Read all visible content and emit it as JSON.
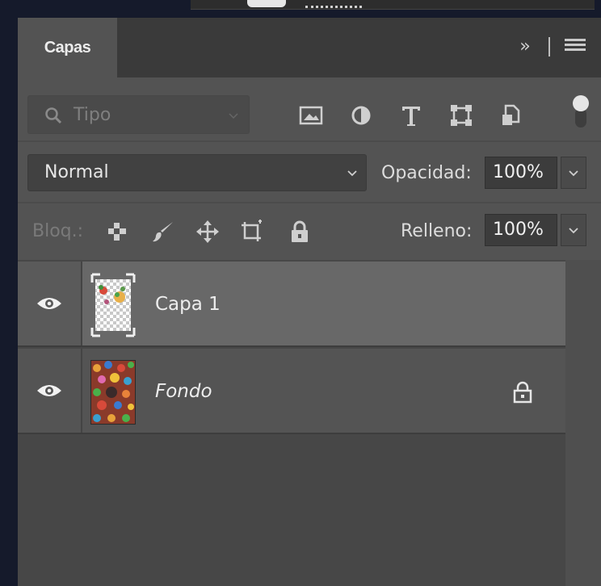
{
  "panel": {
    "tab_label": "Capas"
  },
  "filter": {
    "placeholder": "Tipo",
    "icons": [
      "image-filter-icon",
      "adjustment-filter-icon",
      "type-filter-icon",
      "shape-filter-icon",
      "smart-object-filter-icon"
    ]
  },
  "blend": {
    "mode": "Normal",
    "opacity_label": "Opacidad:",
    "opacity_value": "100%"
  },
  "locks": {
    "label": "Bloq.:",
    "icons": [
      "lock-transparent-icon",
      "lock-image-icon",
      "lock-position-icon",
      "lock-artboard-icon",
      "lock-all-icon"
    ],
    "fill_label": "Relleno:",
    "fill_value": "100%"
  },
  "layers": [
    {
      "name": "Capa 1",
      "visible": true,
      "selected": true,
      "italic": false,
      "locked": false
    },
    {
      "name": "Fondo",
      "visible": true,
      "selected": false,
      "italic": true,
      "locked": true
    }
  ]
}
